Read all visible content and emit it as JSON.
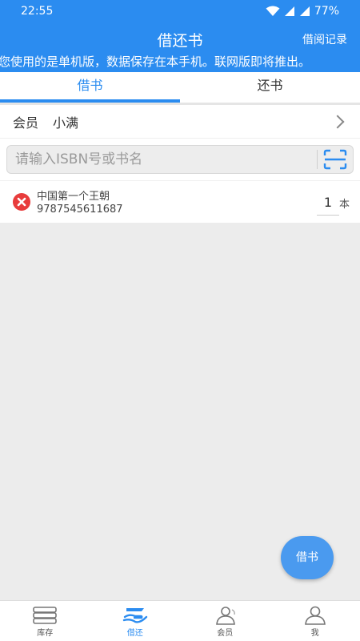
{
  "status_bar": {
    "time": "22:55",
    "battery": "77%"
  },
  "header": {
    "title": "借还书",
    "record_link": "借阅记录"
  },
  "notice": "您使用的是单机版，数据保存在本手机。联网版即将推出。",
  "tabs": [
    {
      "label": "借书",
      "active": true
    },
    {
      "label": "还书",
      "active": false
    }
  ],
  "member": {
    "label": "会员",
    "name": "小满"
  },
  "search": {
    "placeholder": "请输入ISBN号或书名"
  },
  "books": [
    {
      "title": "中国第一个王朝",
      "isbn": "9787545611687",
      "quantity": "1",
      "unit": "本"
    }
  ],
  "fab_label": "借书",
  "bottom_nav": [
    {
      "label": "库存",
      "icon": "books-icon",
      "active": false
    },
    {
      "label": "借还",
      "icon": "borrow-hand-icon",
      "active": true
    },
    {
      "label": "会员",
      "icon": "members-icon",
      "active": false
    },
    {
      "label": "我",
      "icon": "person-icon",
      "active": false
    }
  ],
  "colors": {
    "primary": "#2b8cf0",
    "delete": "#e83c3c",
    "background": "#ececec"
  }
}
